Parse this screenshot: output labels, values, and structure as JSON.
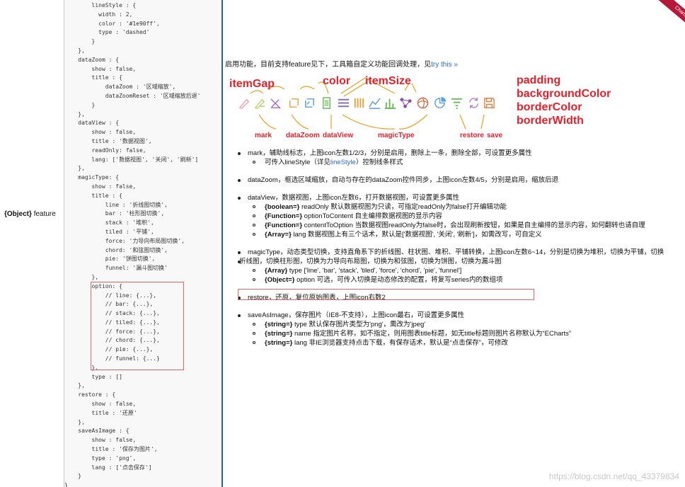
{
  "property_label": {
    "type": "{Object}",
    "name": "feature"
  },
  "code_lines": [
    "        lineStyle : {",
    "          width : 2,",
    "          color : '#1e90ff',",
    "          type : 'dashed'",
    "        }",
    "    },",
    "    dataZoom : {",
    "        show : false,",
    "        title : {",
    "            dataZoom : '区域缩放',",
    "            dataZoomReset : '区域缩放后退'",
    "        }",
    "    },",
    "    dataView : {",
    "        show : false,",
    "        title : '数据视图',",
    "        readOnly: false,",
    "        lang: ['数据视图', '关闭', '刷新']",
    "    },",
    "    magicType: {",
    "        show : false,",
    "        title : {",
    "            line : '折线图切换',",
    "            bar : '柱形图切换',",
    "            stack : '堆积',",
    "            tiled : '平铺',",
    "            force: '力导向布局图切换',",
    "            chord: '和弦图切换',",
    "            pie: '饼图切换',",
    "            funnel: '漏斗图切换'",
    "        },",
    "        option: {",
    "            // line: {...},",
    "            // bar: {...},",
    "            // stack: {...},",
    "            // tiled: {...},",
    "            // force: {...},",
    "            // chord: {...},",
    "            // pie: {...},",
    "            // funnel: {...}",
    "        },",
    "        type : []",
    "    },",
    "    restore : {",
    "        show : false,",
    "        title : '还原'",
    "    },",
    "    saveAsImage : {",
    "        show : false,",
    "        title : '保存为图片',",
    "        type : 'png',",
    "        lang : ['点击保存']",
    "    }",
    "}"
  ],
  "intro": {
    "text": "启用功能，目前支持feature见下，工具箱自定义功能回调处理，见",
    "link": "try this »"
  },
  "figure": {
    "top_labels": {
      "itemGap": "itemGap",
      "color": "color",
      "itemSize": "itemSize"
    },
    "right_labels": [
      "padding",
      "backgroundColor",
      "borderColor",
      "borderWidth"
    ],
    "bottom_labels": {
      "mark": "mark",
      "dataZoom": "dataZoom",
      "dataView": "dataView",
      "magicType": "magicType",
      "restore": "restore",
      "save": "save"
    },
    "icon_colors": {
      "mark": "#e8a3b0",
      "dataZoom": "#5aa0dc",
      "dataView": "#66bb55",
      "magicType": "#b07bd0",
      "restore": "#e0a030",
      "save": "#e07a3a"
    }
  },
  "bullets": {
    "mark": {
      "text": "mark，辅助线标志，上图icon左数1/2/3，分别是启用，删除上一条，删除全部，可设置更多属性",
      "sub": [
        "可传入lineStyle（详见",
        "lineStyle",
        "）控制线条样式"
      ]
    },
    "dataZoom": {
      "text": "dataZoom，框选区域缩放，自动与存在的dataZoom控件同步，上图icon左数4/5，分别是启用，缩放后退"
    },
    "dataView": {
      "text": "dataView，数据视图，上图icon左数6，打开数据视图，可设置更多属性",
      "subs": [
        {
          "kw": "{boolean=}",
          "text": " readOnly 默认数据视图为只读，可指定readOnly为false打开编辑功能"
        },
        {
          "kw": "{Function=}",
          "text": " optionToContent 自主编排数据视图的显示内容"
        },
        {
          "kw": "{Function=}",
          "text": " contentToOption 当数据视图readOnly为false时，会出现刷新按钮，如果是自主编排的显示内容，如何翻转也请自理"
        },
        {
          "kw": "{Array=}",
          "text": " lang 数据视图上有三个话术，默认是['数据视图', '关闭', '刷新']，如需改写，可自定义"
        }
      ]
    },
    "magicType": {
      "text": "magicType，动态类型切换，支持直角系下的折线图、柱状图、堆积、平铺转换，上图icon左数6~14，分别是切换为堆积，切换为平铺，切换",
      "text2": "折线图，切换柱形图，切换为力导向布局图，切换为和弦图，切换为饼图，切换为漏斗图",
      "subs": [
        {
          "kw": "{Array}",
          "text": " type ['line', 'bar', 'stack', 'tiled', 'force', 'chord', 'pie', 'funnel']"
        },
        {
          "kw": "{Object=}",
          "text": " option 可选，可传入切换是动态修改的配置，将复写series内的数组项"
        }
      ]
    },
    "restore": {
      "text": "restore，还原，复位原始图表，上图icon右数2"
    },
    "saveAsImage": {
      "text": "saveAsImage，保存图片（IE8-不支持），上图icon最右，可设置更多属性",
      "subs": [
        {
          "kw": "{string=}",
          "text": " type 默认保存图片类型为'png'，需改为'jpeg'"
        },
        {
          "kw": "{string=}",
          "text": " name 指定图片名称，如不指定，则用图表title标题，如无title标题则图片名称默认为“ECharts”"
        },
        {
          "kw": "{string=}",
          "text": " lang 非IE浏览器支持点击下载，有保存话术，默认是“点击保存”，可修改"
        }
      ]
    }
  },
  "ribbon": "Charts 3",
  "watermark": "https://blog.csdn.net/qq_43379834"
}
